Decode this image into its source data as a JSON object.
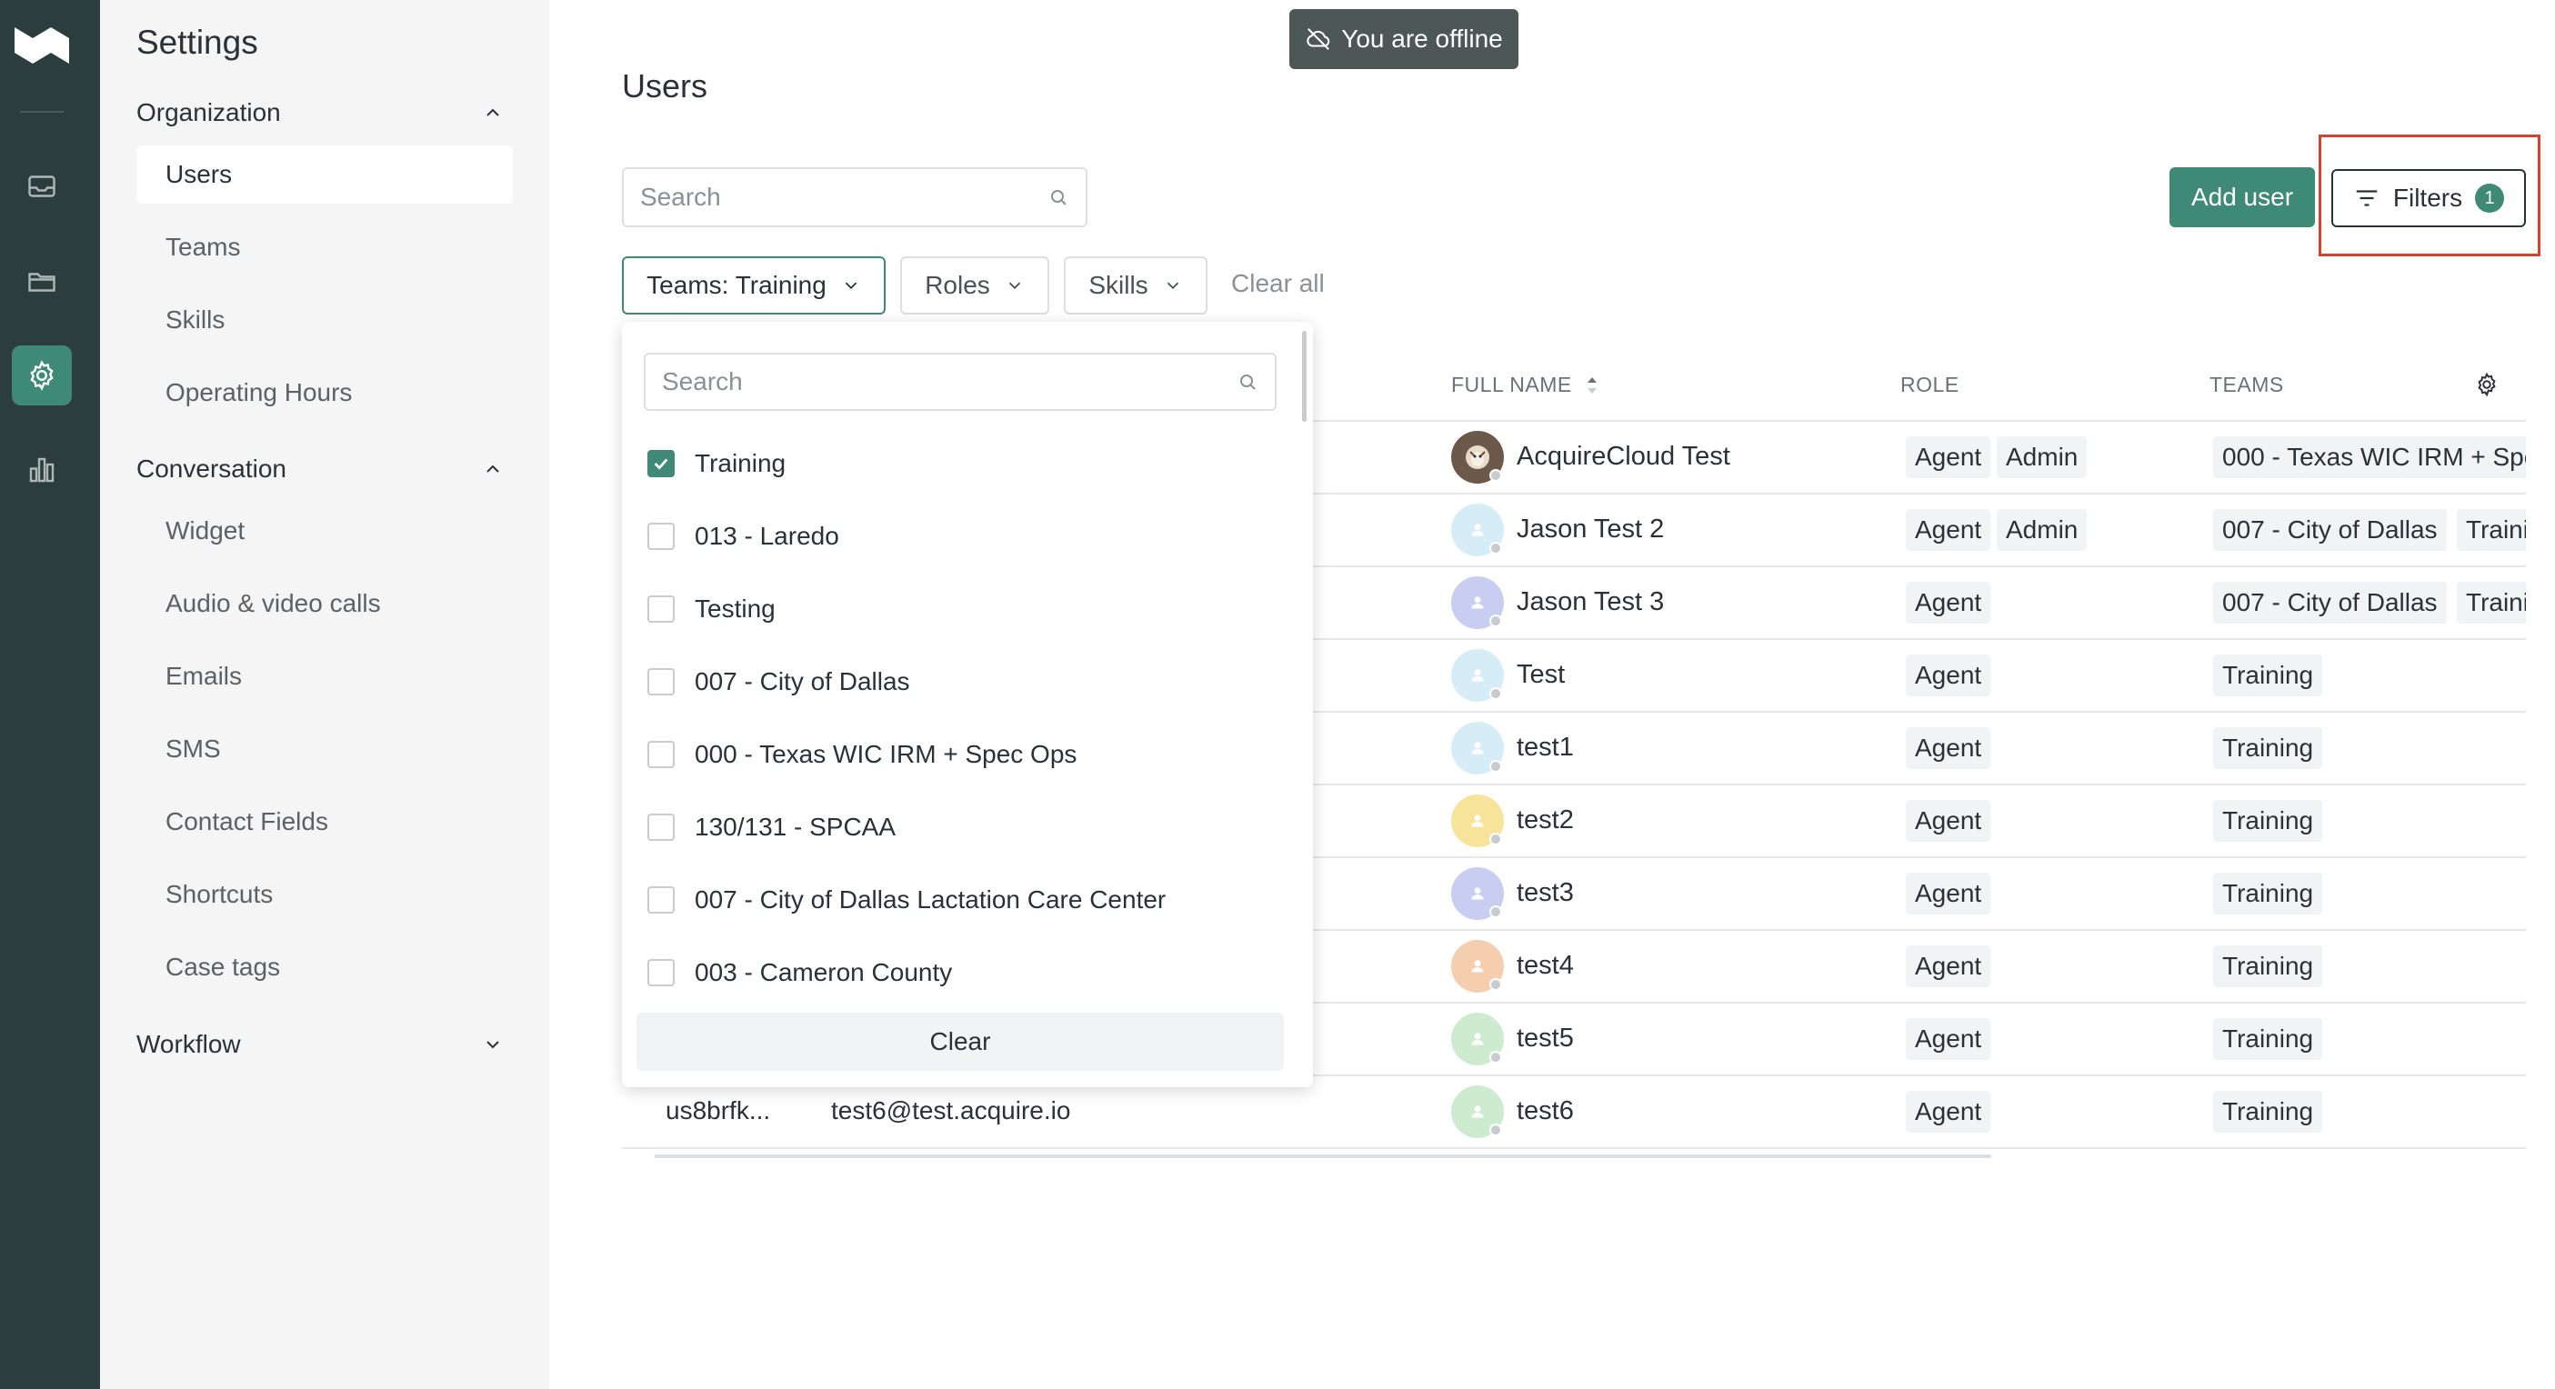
{
  "offline": {
    "text": "You are offline"
  },
  "sidebar": {
    "title": "Settings",
    "sections": [
      {
        "label": "Organization",
        "items": [
          "Users",
          "Teams",
          "Skills",
          "Operating Hours"
        ]
      },
      {
        "label": "Conversation",
        "items": [
          "Widget",
          "Audio & video calls",
          "Emails",
          "SMS",
          "Contact Fields",
          "Shortcuts",
          "Case tags"
        ]
      },
      {
        "label": "Workflow",
        "items": []
      }
    ],
    "active_item": "Users"
  },
  "page": {
    "title": "Users"
  },
  "search": {
    "placeholder": "Search"
  },
  "toolbar": {
    "add_user": "Add user",
    "filters": "Filters",
    "filters_count": "1"
  },
  "filters": {
    "teams": "Teams: Training",
    "roles": "Roles",
    "skills": "Skills",
    "clear_all": "Clear all"
  },
  "table": {
    "headers": {
      "full_name": "FULL NAME",
      "role": "ROLE",
      "teams": "TEAMS"
    },
    "rows": [
      {
        "name": "AcquireCloud Test",
        "roles": [
          "Agent",
          "Admin"
        ],
        "teams": [
          "000 - Texas WIC IRM + Spe"
        ],
        "avatar_color": "#6b5a4a",
        "avatar": "photo"
      },
      {
        "name": "Jason Test 2",
        "roles": [
          "Agent",
          "Admin"
        ],
        "teams": [
          "007 - City of Dallas",
          "Trainin"
        ],
        "avatar_color": "#d6ecf7"
      },
      {
        "name": "Jason Test 3",
        "roles": [
          "Agent"
        ],
        "teams": [
          "007 - City of Dallas",
          "Trainin"
        ],
        "avatar_color": "#c8cdf2"
      },
      {
        "name": "Test",
        "roles": [
          "Agent"
        ],
        "teams": [
          "Training"
        ],
        "avatar_color": "#d6ecf7"
      },
      {
        "name": "test1",
        "roles": [
          "Agent"
        ],
        "teams": [
          "Training"
        ],
        "avatar_color": "#d6ecf7"
      },
      {
        "name": "test2",
        "roles": [
          "Agent"
        ],
        "teams": [
          "Training"
        ],
        "avatar_color": "#f7e39a"
      },
      {
        "name": "test3",
        "roles": [
          "Agent"
        ],
        "teams": [
          "Training"
        ],
        "avatar_color": "#c8cdf2"
      },
      {
        "name": "test4",
        "roles": [
          "Agent"
        ],
        "teams": [
          "Training"
        ],
        "avatar_color": "#f5ceb0"
      },
      {
        "name": "test5",
        "roles": [
          "Agent"
        ],
        "teams": [
          "Training"
        ],
        "avatar_color": "#cdeccf"
      },
      {
        "name": "test6",
        "roles": [
          "Agent"
        ],
        "teams": [
          "Training"
        ],
        "avatar_color": "#cdeccf",
        "id": "us8brfk...",
        "email": "test6@test.acquire.io"
      }
    ]
  },
  "dropdown": {
    "search_placeholder": "Search",
    "options": [
      {
        "label": "Training",
        "checked": true
      },
      {
        "label": "013 - Laredo",
        "checked": false
      },
      {
        "label": "Testing",
        "checked": false
      },
      {
        "label": "007 - City of Dallas",
        "checked": false
      },
      {
        "label": "000 - Texas WIC IRM + Spec Ops",
        "checked": false
      },
      {
        "label": "130/131 - SPCAA",
        "checked": false
      },
      {
        "label": "007 - City of Dallas Lactation Care Center",
        "checked": false
      },
      {
        "label": "003 - Cameron County",
        "checked": false
      }
    ],
    "clear": "Clear"
  },
  "colors": {
    "accent": "#3f8a76",
    "rail": "#2c3d3d",
    "highlight": "#d9412f"
  },
  "icons": [
    "logo-icon",
    "inbox-icon",
    "folder-icon",
    "settings-icon",
    "analytics-icon",
    "search-icon",
    "filter-icon",
    "chevron-down-icon",
    "chevron-up-icon",
    "sort-icon",
    "gear-icon",
    "offline-cloud-icon",
    "checkbox-icon",
    "user-icon"
  ]
}
